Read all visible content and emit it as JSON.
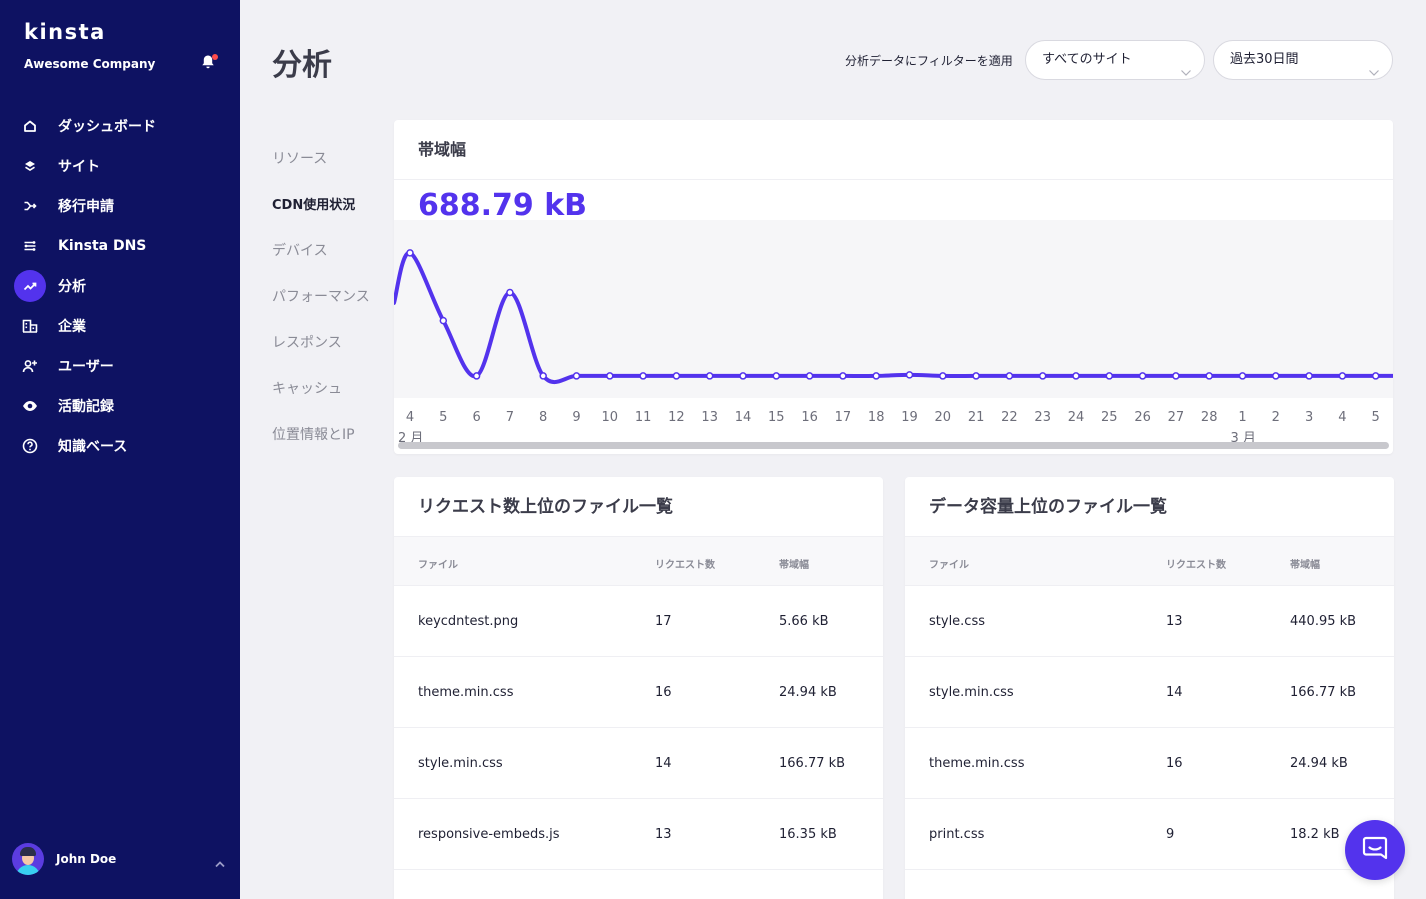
{
  "brand": {
    "logo_text": "kinsta",
    "company": "Awesome Company"
  },
  "nav": {
    "items": [
      {
        "label": "ダッシュボード",
        "icon": "home-icon"
      },
      {
        "label": "サイト",
        "icon": "layers-icon"
      },
      {
        "label": "移行申請",
        "icon": "migration-icon"
      },
      {
        "label": "Kinsta DNS",
        "icon": "dns-icon"
      },
      {
        "label": "分析",
        "icon": "analytics-icon",
        "active": true
      },
      {
        "label": "企業",
        "icon": "company-icon"
      },
      {
        "label": "ユーザー",
        "icon": "add-user-icon"
      },
      {
        "label": "活動記録",
        "icon": "eye-icon"
      },
      {
        "label": "知識ベース",
        "icon": "help-icon"
      }
    ]
  },
  "user": {
    "name": "John Doe"
  },
  "header": {
    "title": "分析",
    "filter_label": "分析データにフィルターを適用",
    "site_select": "すべてのサイト",
    "range_select": "過去30日間"
  },
  "subnav": {
    "items": [
      "リソース",
      "CDN使用状況",
      "デバイス",
      "パフォーマンス",
      "レスポンス",
      "キャッシュ",
      "位置情報とIP"
    ],
    "active_index": 1
  },
  "bandwidth": {
    "title": "帯域幅",
    "total": "688.79 kB"
  },
  "chart_data": {
    "type": "line",
    "title": "帯域幅",
    "x": [
      "4",
      "5",
      "6",
      "7",
      "8",
      "9",
      "10",
      "11",
      "12",
      "13",
      "14",
      "15",
      "16",
      "17",
      "18",
      "19",
      "20",
      "21",
      "22",
      "23",
      "24",
      "25",
      "26",
      "27",
      "28",
      "1",
      "2",
      "3",
      "4",
      "5"
    ],
    "month_labels": [
      {
        "index": 0,
        "label": "2 月"
      },
      {
        "index": 25,
        "label": "3 月"
      }
    ],
    "series": [
      {
        "values": [
          120,
          55,
          2,
          82,
          2,
          2,
          2,
          2,
          2,
          2,
          2,
          2,
          2,
          2,
          2,
          3,
          2,
          2,
          2,
          2,
          2,
          2,
          2,
          2,
          2,
          2,
          2,
          2,
          2,
          2
        ]
      }
    ],
    "ylim": [
      0,
      140
    ],
    "color": "#5333ed",
    "grid": false
  },
  "tables": {
    "top_requests": {
      "title": "リクエスト数上位のファイル一覧",
      "columns": [
        "ファイル",
        "リクエスト数",
        "帯域幅"
      ],
      "rows": [
        [
          "keycdntest.png",
          "17",
          "5.66 kB"
        ],
        [
          "theme.min.css",
          "16",
          "24.94 kB"
        ],
        [
          "style.min.css",
          "14",
          "166.77 kB"
        ],
        [
          "responsive-embeds.js",
          "13",
          "16.35 kB"
        ]
      ]
    },
    "top_bandwidth": {
      "title": "データ容量上位のファイル一覧",
      "columns": [
        "ファイル",
        "リクエスト数",
        "帯域幅"
      ],
      "rows": [
        [
          "style.css",
          "13",
          "440.95 kB"
        ],
        [
          "style.min.css",
          "14",
          "166.77 kB"
        ],
        [
          "theme.min.css",
          "16",
          "24.94 kB"
        ],
        [
          "print.css",
          "9",
          "18.2 kB"
        ]
      ]
    }
  },
  "colors": {
    "sidebar": "#0e1262",
    "accent": "#5333ed",
    "background": "#f1f1f5"
  }
}
